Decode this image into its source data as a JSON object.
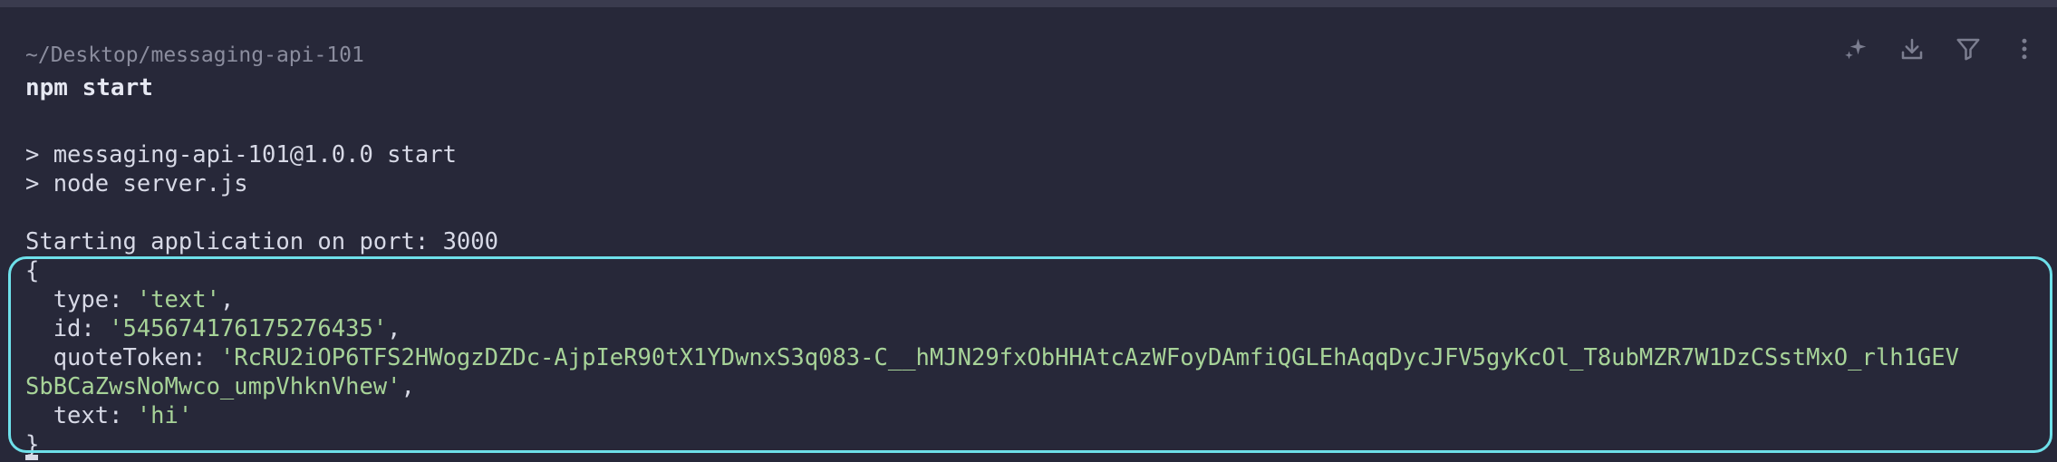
{
  "block": {
    "cwd": "~/Desktop/messaging-api-101",
    "command": "npm start"
  },
  "toolbar": {
    "icons": [
      "sparkle-icon",
      "download-icon",
      "filter-icon",
      "more-vertical-icon"
    ]
  },
  "output": {
    "npm_script_line": "> messaging-api-101@1.0.0 start",
    "node_line": "> node server.js",
    "startup_line": "Starting application on port: 3000",
    "open_brace": "{",
    "type_key": "  type: ",
    "type_value": "'text'",
    "id_key": "  id: ",
    "id_value": "'545674176175276435'",
    "quote_key": "  quoteToken: ",
    "quote_value_part1": "'RcRU2iOP6TFS2HWogzDZDc-AjpIeR90tX1YDwnxS3q083-C__hMJN29fxObHHAtcAzWFoyDAmfiQGLEhAqqDycJFV5gyKcOl_T8ubMZR7W1DzCSstMxO_rlh1GEV",
    "quote_value_part2": "SbBCaZwsNoMwco_umpVhknVhew'",
    "text_key": "  text: ",
    "text_value": "'hi'",
    "close_brace": "}",
    "comma": ","
  },
  "colors": {
    "background": "#272839",
    "string": "#a7d398",
    "highlight_border": "#6ee0ea"
  }
}
